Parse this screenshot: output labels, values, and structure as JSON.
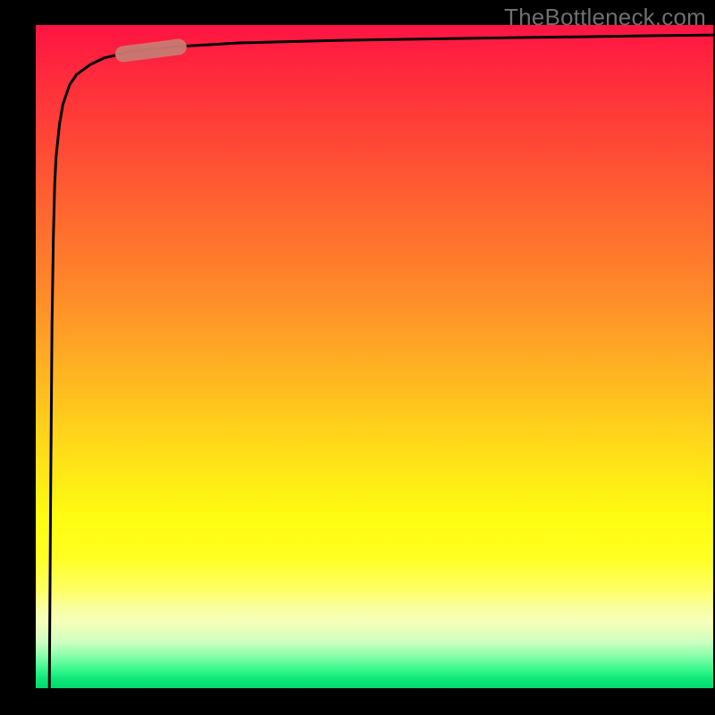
{
  "watermark": "TheBottleneck.com",
  "chart_data": {
    "type": "line",
    "title": "",
    "xlabel": "",
    "ylabel": "",
    "xlim": [
      0,
      100
    ],
    "ylim": [
      0,
      100
    ],
    "background_gradient": {
      "top": "#ff1442",
      "mid_upper": "#ff9628",
      "mid": "#ffe916",
      "mid_lower": "#fdff6e",
      "bottom": "#00da6e"
    },
    "series": [
      {
        "name": "bottleneck-curve",
        "x": [
          2,
          2.2,
          2.4,
          2.6,
          2.8,
          3.0,
          3.5,
          4,
          5,
          6,
          8,
          10,
          14,
          20,
          30,
          45,
          65,
          85,
          100
        ],
        "y": [
          0,
          30,
          55,
          68,
          76,
          80,
          85,
          88,
          91,
          92.5,
          94,
          95,
          96,
          96.7,
          97.3,
          97.7,
          98,
          98.3,
          98.5
        ]
      }
    ],
    "marker": {
      "name": "highlight-segment",
      "x_range": [
        12,
        22
      ],
      "y_approx": 96,
      "color": "#c97a72"
    }
  }
}
